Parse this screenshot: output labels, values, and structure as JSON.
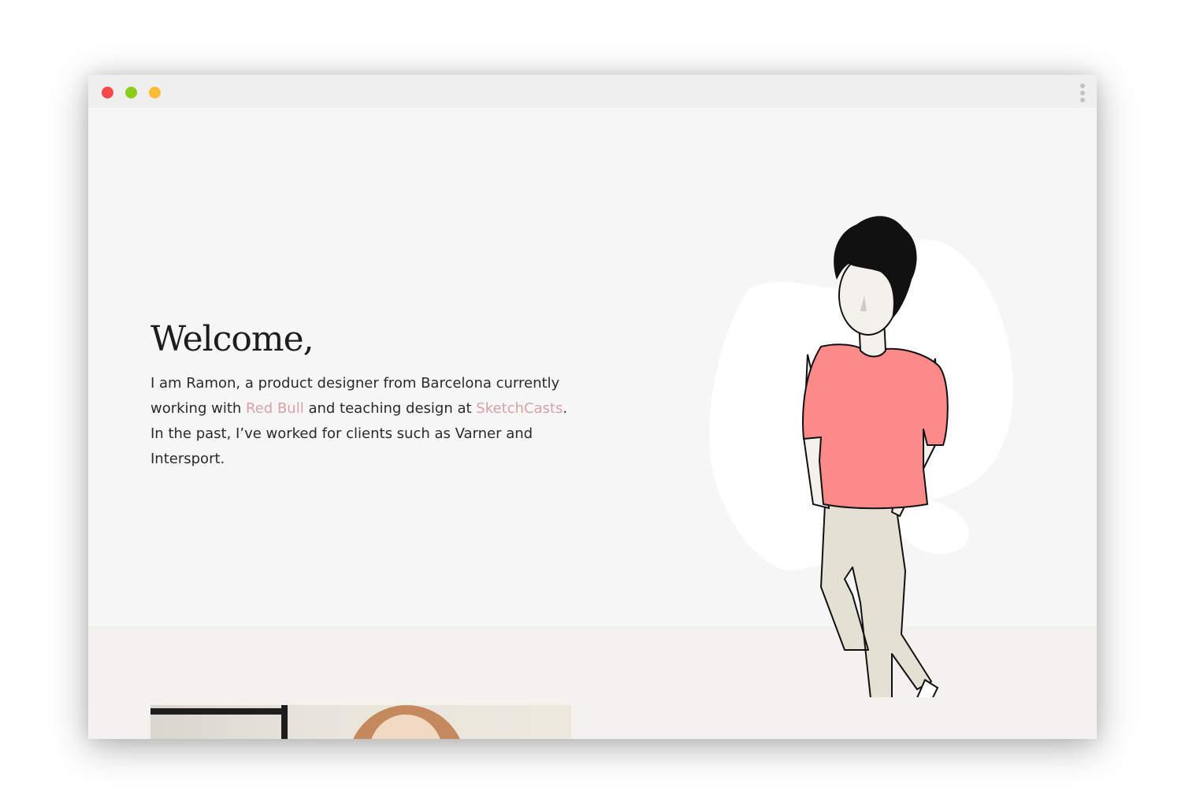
{
  "window": {
    "traffic_lights": {
      "close": "#f84848",
      "minimize": "#8ccc1b",
      "maximize": "#fbbb36"
    },
    "menu_icon": "vertical-ellipsis"
  },
  "hero": {
    "title": "Welcome,",
    "intro_part1": "I am Ramon, a product designer from Barcelona currently working with ",
    "link_redbull": "Red Bull",
    "intro_part2": " and teaching design at ",
    "link_sketchcasts": "SketchCasts",
    "intro_part3": ". In the past, I’ve worked for clients such as Varner and Intersport.",
    "link_color": "#d8a1a6",
    "illustration": "standing-man-illustration",
    "shirt_color": "#fd8a8a",
    "pants_color": "#e4e0d4"
  },
  "lower_section": {
    "background": "#f4f2ef",
    "image": "portrait-photo"
  }
}
